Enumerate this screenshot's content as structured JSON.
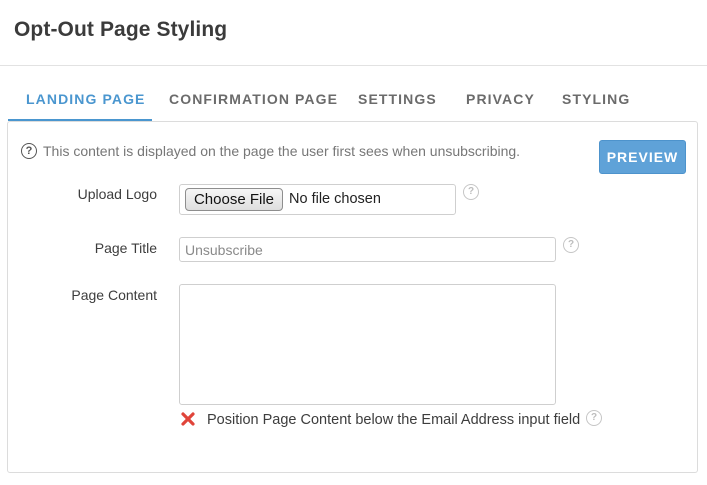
{
  "header": {
    "title": "Opt-Out Page Styling"
  },
  "tabs": [
    {
      "label": "LANDING PAGE",
      "active": true
    },
    {
      "label": "CONFIRMATION PAGE",
      "active": false
    },
    {
      "label": "SETTINGS",
      "active": false
    },
    {
      "label": "PRIVACY",
      "active": false
    },
    {
      "label": "STYLING",
      "active": false
    }
  ],
  "info": {
    "icon": "question-circle-icon",
    "text": "This content is displayed on the page the user first sees when unsubscribing."
  },
  "preview_button": {
    "label": "PREVIEW"
  },
  "form": {
    "upload_logo": {
      "label": "Upload Logo",
      "button_label": "Choose File",
      "status": "No file chosen"
    },
    "page_title": {
      "label": "Page Title",
      "value": "",
      "placeholder": "Unsubscribe"
    },
    "page_content": {
      "label": "Page Content",
      "value": ""
    },
    "position_option": {
      "label": "Position Page Content below the Email Address input field",
      "checked": false,
      "icon": "red-x-icon"
    }
  },
  "help_icon": "?",
  "colors": {
    "accent": "#4a96cf",
    "button": "#5fa2d8",
    "cross": "#e0443a"
  }
}
